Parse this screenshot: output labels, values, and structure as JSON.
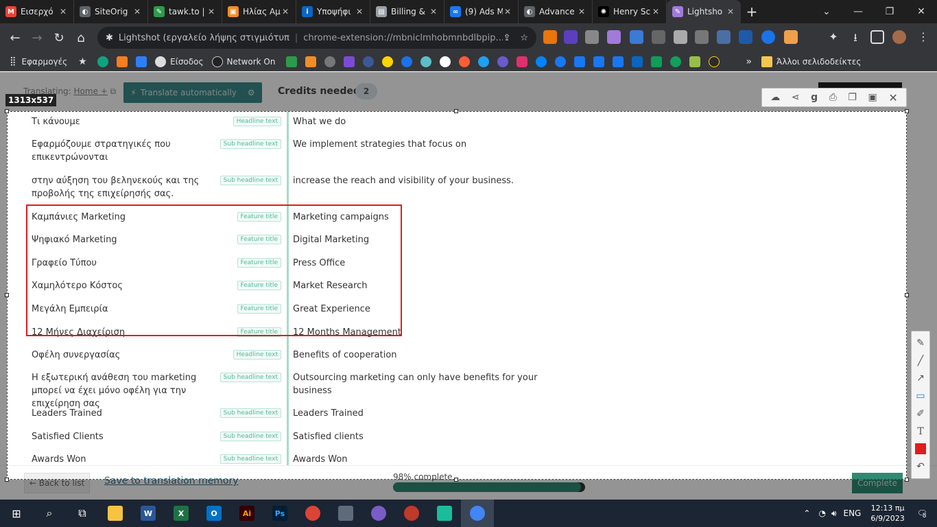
{
  "browser": {
    "tabs": [
      {
        "title": "Εισερχό",
        "favicon": "gmail-icon",
        "color": "#ea4335",
        "letter": "M"
      },
      {
        "title": "SiteOrig",
        "favicon": "globe-icon",
        "color": "#5f6368",
        "letter": "◐"
      },
      {
        "title": "tawk.to |",
        "favicon": "tawk-icon",
        "color": "#2d9b4a",
        "letter": "✎"
      },
      {
        "title": "Ηλίας Αμ",
        "favicon": "hubspot-icon",
        "color": "#f28c28",
        "letter": "▣"
      },
      {
        "title": "Υποψήφι",
        "favicon": "linkedin-icon",
        "color": "#0a66c2",
        "letter": "i"
      },
      {
        "title": "Billing &",
        "favicon": "billing-icon",
        "color": "#9aa0a6",
        "letter": "▤"
      },
      {
        "title": "(9) Ads M",
        "favicon": "meta-icon",
        "color": "#1877f2",
        "letter": "∞"
      },
      {
        "title": "Advance",
        "favicon": "globe-icon",
        "color": "#5f6368",
        "letter": "◐"
      },
      {
        "title": "Henry Sc",
        "favicon": "openai-icon",
        "color": "#000000",
        "letter": "✺"
      },
      {
        "title": "Lightsho",
        "favicon": "lightshot-icon",
        "color": "#a07bd8",
        "letter": "✎"
      }
    ],
    "new_tab_label": "+",
    "omnibox": {
      "title": "Lightshot (εργαλείο λήψης στιγμιότυπ",
      "url": "chrome-extension://mbniclmhobmnbdlbpip..."
    },
    "bookmarks": {
      "apps_label": "Εφαρμογές",
      "signin_label": "Είσοδος",
      "network_label": "Network On",
      "more_label": "»",
      "other_label": "Άλλοι σελιδοδείκτες"
    }
  },
  "page": {
    "translating_label": "Translating:",
    "translating_link": "Home +",
    "auto_translate_label": "Translate automatically",
    "credits_label": "Credits needed",
    "credits_value": "2",
    "rows": [
      {
        "source": "Τι κάνουμε",
        "tag": "Headline text",
        "target": "What we do"
      },
      {
        "source": "Εφαρμόζουμε στρατηγικές που επικεντρώνονται",
        "tag": "Sub headline text",
        "target": "We implement strategies that focus on"
      },
      {
        "source": "στην αύξηση του βεληνεκούς και της προβολής της επιχείρησής σας.",
        "tag": "Sub headline text",
        "target": "increase the reach and visibility of your business."
      },
      {
        "source": "Καμπάνιες Marketing",
        "tag": "Feature title",
        "target": "Marketing campaigns"
      },
      {
        "source": "Ψηφιακό Marketing",
        "tag": "Feature title",
        "target": "Digital Marketing"
      },
      {
        "source": "Γραφείο Τύπου",
        "tag": "Feature title",
        "target": "Press Office"
      },
      {
        "source": "Χαμηλότερο Κόστος",
        "tag": "Feature title",
        "target": "Market Research"
      },
      {
        "source": "Μεγάλη Εμπειρία",
        "tag": "Feature title",
        "target": "Great Experience"
      },
      {
        "source": "12 Μήνες Διαχείριση",
        "tag": "Feature title",
        "target": "12 Months Management"
      },
      {
        "source": "Οφέλη συνεργασίας",
        "tag": "Headline text",
        "target": "Benefits of cooperation"
      },
      {
        "source": "Η εξωτερική ανάθεση του marketing μπορεί να έχει μόνο οφέλη για την επιχείρηση σας",
        "tag": "Sub headline text",
        "target": "Outsourcing marketing can only have benefits for your business"
      },
      {
        "source": "Leaders Trained",
        "tag": "Sub headline text",
        "target": "Leaders Trained"
      },
      {
        "source": "Satisfied Clients",
        "tag": "Sub headline text",
        "target": "Satisfied clients"
      },
      {
        "source": "Awards Won",
        "tag": "Sub headline text",
        "target": "Awards Won"
      }
    ],
    "back_label": "← Back to list",
    "save_tm_label": "Save to translation memory",
    "progress_label": "98% complete",
    "progress_value": 0.98,
    "complete_label": "Complete"
  },
  "lightshot": {
    "size_label": "1313x537",
    "top_tools": [
      "upload-icon",
      "share-icon",
      "google-search-icon",
      "print-icon",
      "copy-icon",
      "save-icon",
      "close-icon"
    ],
    "side_tools": [
      "pen-icon",
      "line-icon",
      "arrow-icon",
      "rectangle-icon",
      "marker-icon",
      "text-icon",
      "color-icon",
      "undo-icon"
    ],
    "annotation_color": "#e01c1c"
  },
  "taskbar": {
    "language": "ENG",
    "time": "12:13 πμ",
    "date": "6/9/2023",
    "notification_count": "8"
  }
}
